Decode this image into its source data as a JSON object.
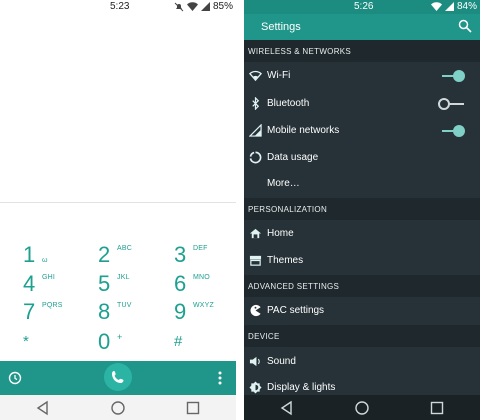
{
  "dialer": {
    "status": {
      "time": "5:23",
      "battery": "85%"
    },
    "keys": [
      {
        "digit": "1",
        "letters": "ω"
      },
      {
        "digit": "2",
        "letters": "ABC"
      },
      {
        "digit": "3",
        "letters": "DEF"
      },
      {
        "digit": "4",
        "letters": "GHI"
      },
      {
        "digit": "5",
        "letters": "JKL"
      },
      {
        "digit": "6",
        "letters": "MNO"
      },
      {
        "digit": "7",
        "letters": "PQRS"
      },
      {
        "digit": "8",
        "letters": "TUV"
      },
      {
        "digit": "9",
        "letters": "WXYZ"
      },
      {
        "digit": "*",
        "letters": ""
      },
      {
        "digit": "0",
        "letters": "+"
      },
      {
        "digit": "#",
        "letters": ""
      }
    ],
    "colors": {
      "accent": "#1ea091",
      "bar": "#20968a"
    }
  },
  "settings": {
    "status": {
      "time": "5:26",
      "battery": "84%"
    },
    "title": "Settings",
    "sections": [
      {
        "header": "WIRELESS & NETWORKS",
        "items": [
          {
            "label": "Wi-Fi",
            "icon": "wifi-icon",
            "toggle": "on"
          },
          {
            "label": "Bluetooth",
            "icon": "bluetooth-icon",
            "toggle": "off"
          },
          {
            "label": "Mobile networks",
            "icon": "signal-icon",
            "toggle": "on"
          },
          {
            "label": "Data usage",
            "icon": "data-usage-icon"
          },
          {
            "label": "More…",
            "icon": ""
          }
        ]
      },
      {
        "header": "PERSONALIZATION",
        "items": [
          {
            "label": "Home",
            "icon": "home-icon"
          },
          {
            "label": "Themes",
            "icon": "themes-icon"
          }
        ]
      },
      {
        "header": "ADVANCED SETTINGS",
        "items": [
          {
            "label": "PAC settings",
            "icon": "pac-icon"
          }
        ]
      },
      {
        "header": "DEVICE",
        "items": [
          {
            "label": "Sound",
            "icon": "volume-icon"
          },
          {
            "label": "Display & lights",
            "icon": "brightness-icon"
          }
        ]
      }
    ],
    "colors": {
      "background": "#263238",
      "appbar": "#20968a",
      "toggle_on": "#7fd0c6"
    }
  }
}
